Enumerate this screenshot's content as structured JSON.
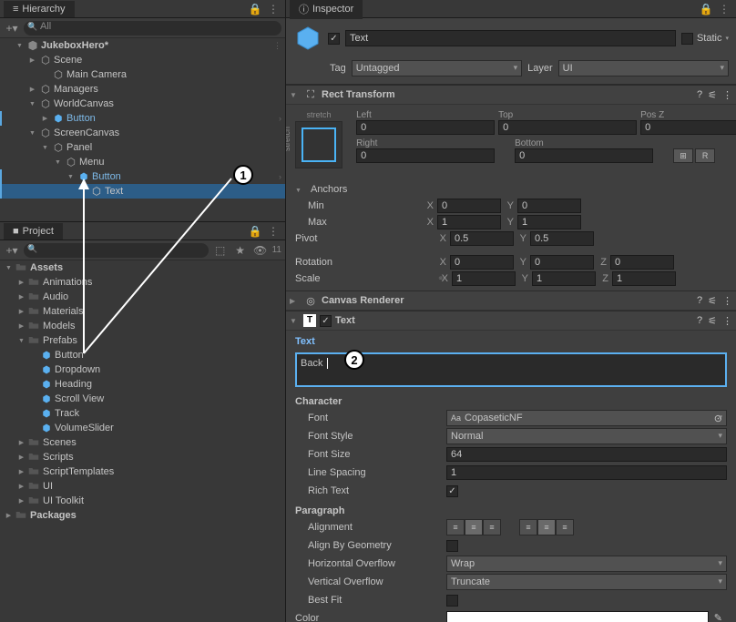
{
  "hierarchy": {
    "tab": "Hierarchy",
    "search_placeholder": "All",
    "items": {
      "root": "JukeboxHero*",
      "scene": "Scene",
      "main_camera": "Main Camera",
      "managers": "Managers",
      "world_canvas": "WorldCanvas",
      "button1": "Button",
      "screen_canvas": "ScreenCanvas",
      "panel": "Panel",
      "menu": "Menu",
      "button2": "Button",
      "text": "Text"
    }
  },
  "project": {
    "tab": "Project",
    "visibility_count": "11",
    "items": {
      "assets": "Assets",
      "animations": "Animations",
      "audio": "Audio",
      "materials": "Materials",
      "models": "Models",
      "prefabs": "Prefabs",
      "prefab_button": "Button",
      "prefab_dropdown": "Dropdown",
      "prefab_heading": "Heading",
      "prefab_scrollview": "Scroll View",
      "prefab_track": "Track",
      "prefab_volumeslider": "VolumeSlider",
      "scenes": "Scenes",
      "scripts": "Scripts",
      "script_templates": "ScriptTemplates",
      "ui": "UI",
      "ui_toolkit": "UI Toolkit",
      "packages": "Packages"
    }
  },
  "inspector": {
    "tab": "Inspector",
    "name": "Text",
    "static_label": "Static",
    "tag_label": "Tag",
    "tag_value": "Untagged",
    "layer_label": "Layer",
    "layer_value": "UI",
    "rect_transform": {
      "title": "Rect Transform",
      "stretch_top": "stretch",
      "stretch_left": "stretch",
      "left_lbl": "Left",
      "left": "0",
      "top_lbl": "Top",
      "top": "0",
      "posz_lbl": "Pos Z",
      "posz": "0",
      "right_lbl": "Right",
      "right": "0",
      "bottom_lbl": "Bottom",
      "bottom": "0",
      "r_btn": "R",
      "anchors_lbl": "Anchors",
      "min_lbl": "Min",
      "min_x": "0",
      "min_y": "0",
      "max_lbl": "Max",
      "max_x": "1",
      "max_y": "1",
      "pivot_lbl": "Pivot",
      "pivot_x": "0.5",
      "pivot_y": "0.5",
      "rotation_lbl": "Rotation",
      "rot_x": "0",
      "rot_y": "0",
      "rot_z": "0",
      "scale_lbl": "Scale",
      "scale_x": "1",
      "scale_y": "1",
      "scale_z": "1"
    },
    "canvas_renderer": {
      "title": "Canvas Renderer"
    },
    "text_component": {
      "title": "Text",
      "text_lbl": "Text",
      "text_value": "Back",
      "character_lbl": "Character",
      "font_lbl": "Font",
      "font_value": "CopaseticNF",
      "font_style_lbl": "Font Style",
      "font_style_value": "Normal",
      "font_size_lbl": "Font Size",
      "font_size_value": "64",
      "line_spacing_lbl": "Line Spacing",
      "line_spacing_value": "1",
      "rich_text_lbl": "Rich Text",
      "paragraph_lbl": "Paragraph",
      "alignment_lbl": "Alignment",
      "align_geometry_lbl": "Align By Geometry",
      "h_overflow_lbl": "Horizontal Overflow",
      "h_overflow_value": "Wrap",
      "v_overflow_lbl": "Vertical Overflow",
      "v_overflow_value": "Truncate",
      "best_fit_lbl": "Best Fit",
      "color_lbl": "Color"
    }
  },
  "callouts": {
    "one": "1",
    "two": "2"
  }
}
